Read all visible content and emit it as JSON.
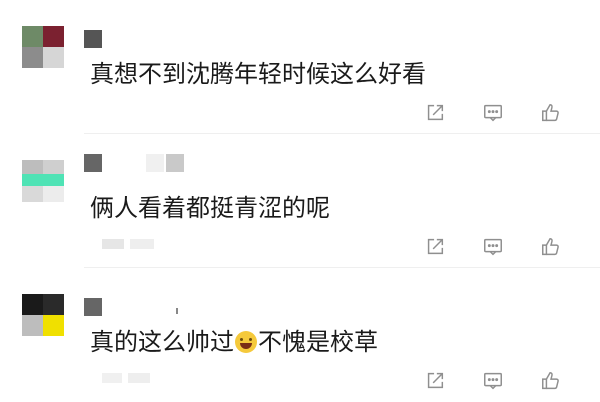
{
  "comments": [
    {
      "text": "真想不到沈腾年轻时候这么好看"
    },
    {
      "text": "俩人看着都挺青涩的呢"
    },
    {
      "text_before_emoji": "真的这么帅过",
      "text_after_emoji": "不愧是校草",
      "emoji": "laughing-emoji"
    }
  ],
  "icons": {
    "share": "share-icon",
    "reply": "comment-icon",
    "like": "thumbs-up-icon"
  },
  "colors": {
    "icon_gray": "#8f8f8f",
    "text": "#1a1a1a"
  }
}
